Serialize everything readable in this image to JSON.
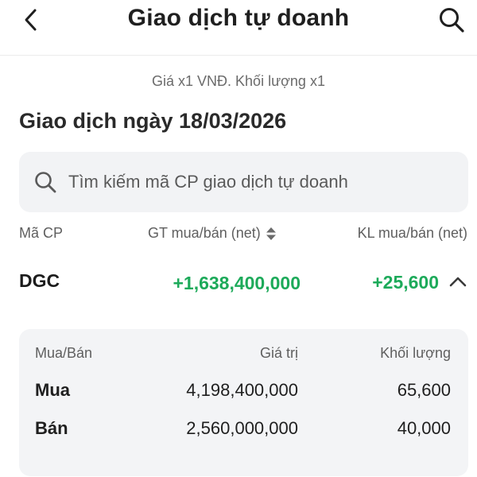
{
  "header": {
    "title": "Giao dịch tự doanh"
  },
  "note": "Giá x1 VNĐ. Khối lượng x1",
  "date_heading": "Giao dịch ngày 18/03/2026",
  "search": {
    "placeholder": "Tìm kiếm mã CP giao dịch tự doanh"
  },
  "columns": {
    "code": "Mã CP",
    "net_value": "GT mua/bán (net)",
    "net_volume": "KL mua/bán (net)"
  },
  "rows": [
    {
      "code": "DGC",
      "net_value": "+1,638,400,000",
      "net_volume": "+25,600",
      "expanded": true,
      "detail": {
        "headers": {
          "side": "Mua/Bán",
          "value": "Giá trị",
          "volume": "Khối lượng"
        },
        "items": [
          {
            "side": "Mua",
            "value": "4,198,400,000",
            "volume": "65,600"
          },
          {
            "side": "Bán",
            "value": "2,560,000,000",
            "volume": "40,000"
          }
        ]
      }
    }
  ],
  "colors": {
    "positive": "#1daa5a",
    "panel_bg": "#f2f3f5"
  },
  "icons": [
    "chevron-left-icon",
    "search-icon",
    "sort-icon",
    "chevron-up-icon"
  ]
}
